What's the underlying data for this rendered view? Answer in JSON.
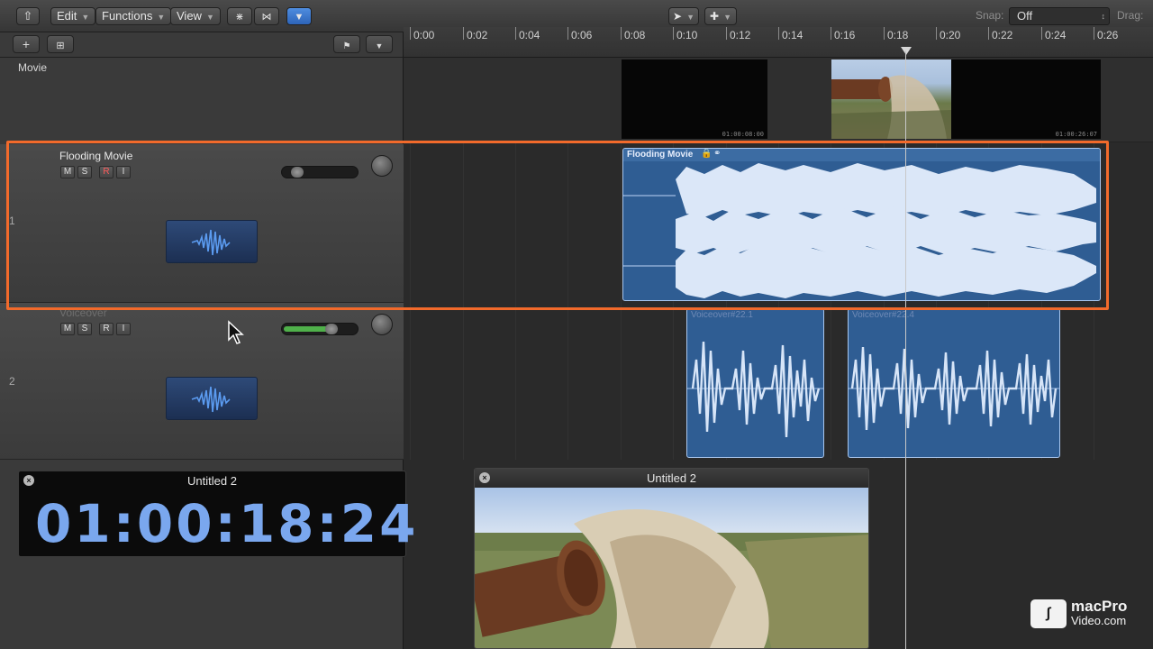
{
  "toolbar": {
    "edit_label": "Edit",
    "functions_label": "Functions",
    "view_label": "View",
    "snap_label": "Snap:",
    "snap_value": "Off",
    "drag_label": "Drag:"
  },
  "ruler": {
    "ticks": [
      "0:00",
      "0:02",
      "0:04",
      "0:06",
      "0:08",
      "0:10",
      "0:12",
      "0:14",
      "0:16",
      "0:18",
      "0:20",
      "0:22",
      "0:24",
      "0:26"
    ]
  },
  "tracks": {
    "movie_label": "Movie",
    "track1": {
      "number": "1",
      "name": "Flooding Movie",
      "mute": "M",
      "solo": "S",
      "record": "R",
      "input": "I",
      "volume_level": 0.15
    },
    "track2": {
      "number": "2",
      "name": "Voiceover",
      "mute": "M",
      "solo": "S",
      "record": "R",
      "input": "I",
      "volume_level": 0.7
    }
  },
  "movie_frames": {
    "tc1": "01:00:08:00",
    "tc2": "01:00:26:07"
  },
  "regions": {
    "flooding": "Flooding Movie",
    "voice1": "Voiceover#22.1",
    "voice2": "Voiceover#22.4"
  },
  "lcd_window": {
    "title": "Untitled 2",
    "timecode": "01:00:18:24"
  },
  "movie_window": {
    "title": "Untitled 2"
  },
  "logo": {
    "line1": "macPro",
    "line2": "Video.com"
  },
  "colors": {
    "highlight": "#f26a2b",
    "region_blue": "#2f5d93",
    "lcd_text": "#7aa7ee"
  }
}
